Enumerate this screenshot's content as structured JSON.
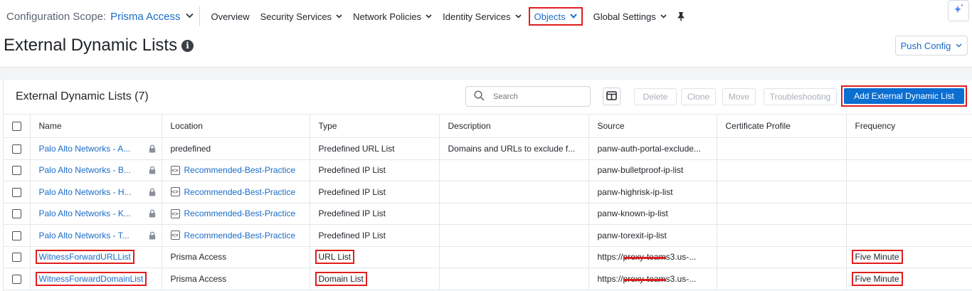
{
  "topnav": {
    "scope_label": "Configuration Scope:",
    "scope_value": "Prisma Access",
    "items": [
      {
        "label": "Overview",
        "has_menu": false
      },
      {
        "label": "Security Services",
        "has_menu": true
      },
      {
        "label": "Network Policies",
        "has_menu": true
      },
      {
        "label": "Identity Services",
        "has_menu": true
      },
      {
        "label": "Objects",
        "has_menu": true,
        "active": true
      },
      {
        "label": "Global Settings",
        "has_menu": true
      }
    ]
  },
  "page": {
    "title": "External Dynamic Lists",
    "push_config_label": "Push Config"
  },
  "panel": {
    "title": "External Dynamic Lists (7)",
    "search_placeholder": "Search",
    "buttons": {
      "delete": "Delete",
      "clone": "Clone",
      "move": "Move",
      "troubleshooting": "Troubleshooting",
      "add": "Add External Dynamic List"
    }
  },
  "table": {
    "columns": [
      "Name",
      "Location",
      "Type",
      "Description",
      "Source",
      "Certificate Profile",
      "Frequency"
    ],
    "rows": [
      {
        "name": "Palo Alto Networks - A...",
        "locked": true,
        "location": "predefined",
        "location_snippet": false,
        "type": "Predefined URL List",
        "description": "Domains and URLs to exclude f...",
        "source": "panw-auth-portal-exclude...",
        "certificate_profile": "",
        "frequency": ""
      },
      {
        "name": "Palo Alto Networks - B...",
        "locked": true,
        "location": "Recommended-Best-Practice",
        "location_snippet": true,
        "type": "Predefined IP List",
        "description": "",
        "source": "panw-bulletproof-ip-list",
        "certificate_profile": "",
        "frequency": ""
      },
      {
        "name": "Palo Alto Networks - H...",
        "locked": true,
        "location": "Recommended-Best-Practice",
        "location_snippet": true,
        "type": "Predefined IP List",
        "description": "",
        "source": "panw-highrisk-ip-list",
        "certificate_profile": "",
        "frequency": ""
      },
      {
        "name": "Palo Alto Networks - K...",
        "locked": true,
        "location": "Recommended-Best-Practice",
        "location_snippet": true,
        "type": "Predefined IP List",
        "description": "",
        "source": "panw-known-ip-list",
        "certificate_profile": "",
        "frequency": ""
      },
      {
        "name": "Palo Alto Networks - T...",
        "locked": true,
        "location": "Recommended-Best-Practice",
        "location_snippet": true,
        "type": "Predefined IP List",
        "description": "",
        "source": "panw-torexit-ip-list",
        "certificate_profile": "",
        "frequency": ""
      },
      {
        "name": "WitnessForwardURLList",
        "locked": false,
        "location": "Prisma Access",
        "location_snippet": false,
        "type": "URL List",
        "description": "",
        "source_prefix": "https://",
        "source_redacted": "proxy-team",
        "source_suffix": "s3.us-...",
        "certificate_profile": "",
        "frequency": "Five Minute",
        "highlighted": true
      },
      {
        "name": "WitnessForwardDomainList",
        "locked": false,
        "location": "Prisma Access",
        "location_snippet": false,
        "type": "Domain List",
        "description": "",
        "source_prefix": "https://",
        "source_redacted": "proxy-team",
        "source_suffix": "s3.us-...",
        "certificate_profile": "",
        "frequency": "Five Minute",
        "highlighted": true
      }
    ]
  },
  "colors": {
    "accent": "#1a6cc7",
    "primary_button": "#0b6ed1",
    "highlight_box": "#e11d1d"
  }
}
